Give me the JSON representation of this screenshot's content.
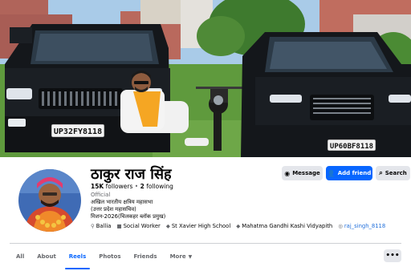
{
  "cover": {
    "plate_left": "UP32FY8118",
    "plate_right": "UP60BF8118"
  },
  "profile": {
    "name": "ठाकुर राज सिंह",
    "followers": "15K",
    "followers_label": "followers",
    "following": "2",
    "following_label": "following",
    "separator": "•",
    "category": "Official",
    "bio": [
      "अखिल भारतीय क्षत्रिय महासभा",
      "(उत्तर प्रदेश महासचिव)",
      "मिशन-2026(चिलकहर ब्लॉक प्रमुख)"
    ]
  },
  "intro": {
    "location": "Ballia",
    "work": "Social Worker",
    "school": "St Xavier High School",
    "college": "Mahatma Gandhi Kashi Vidyapith",
    "instagram": "raj_singh_8118"
  },
  "actions": {
    "message": "Message",
    "add_friend": "Add friend",
    "search": "Search"
  },
  "tabs": [
    {
      "label": "All"
    },
    {
      "label": "About"
    },
    {
      "label": "Reels"
    },
    {
      "label": "Photos"
    },
    {
      "label": "Friends"
    },
    {
      "label": "More"
    }
  ],
  "more_options": "•••",
  "colors": {
    "accent": "#0866ff",
    "link": "#216fdb",
    "button_gray": "#e4e6eb",
    "secondary_text": "#65676b"
  },
  "icons": {
    "message": "messenger-icon",
    "add_friend": "add-person-icon",
    "search": "search-icon",
    "location": "location-pin-icon",
    "work": "briefcase-icon",
    "school": "graduation-cap-icon",
    "instagram": "instagram-icon"
  }
}
